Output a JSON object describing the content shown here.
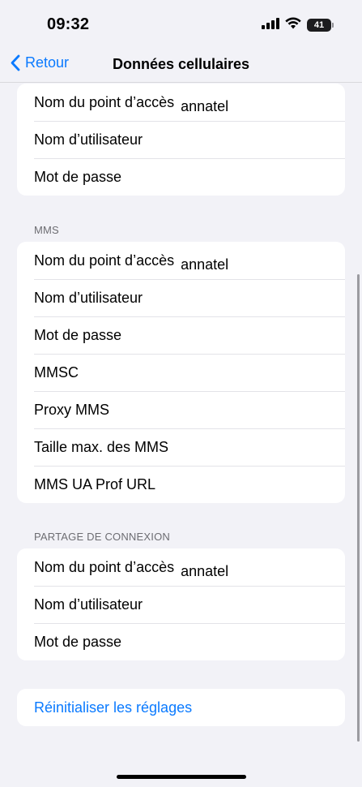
{
  "status_bar": {
    "time": "09:32",
    "battery_level": "41"
  },
  "nav": {
    "back_label": "Retour",
    "title": "Données cellulaires"
  },
  "sections": [
    {
      "header": "",
      "rows": [
        {
          "label": "Nom du point d’accès",
          "value": "annatel"
        },
        {
          "label": "Nom d’utilisateur",
          "value": ""
        },
        {
          "label": "Mot de passe",
          "value": ""
        }
      ]
    },
    {
      "header": "MMS",
      "rows": [
        {
          "label": "Nom du point d’accès",
          "value": "annatel"
        },
        {
          "label": "Nom d’utilisateur",
          "value": ""
        },
        {
          "label": "Mot de passe",
          "value": ""
        },
        {
          "label": "MMSC",
          "value": ""
        },
        {
          "label": "Proxy MMS",
          "value": ""
        },
        {
          "label": "Taille max. des MMS",
          "value": ""
        },
        {
          "label": "MMS UA Prof URL",
          "value": ""
        }
      ]
    },
    {
      "header": "PARTAGE DE CONNEXION",
      "rows": [
        {
          "label": "Nom du point d’accès",
          "value": "annatel"
        },
        {
          "label": "Nom d’utilisateur",
          "value": ""
        },
        {
          "label": "Mot de passe",
          "value": ""
        }
      ]
    }
  ],
  "reset": {
    "label": "Réinitialiser les réglages"
  },
  "colors": {
    "accent": "#0a7aff",
    "background": "#f2f2f7",
    "card": "#ffffff"
  }
}
